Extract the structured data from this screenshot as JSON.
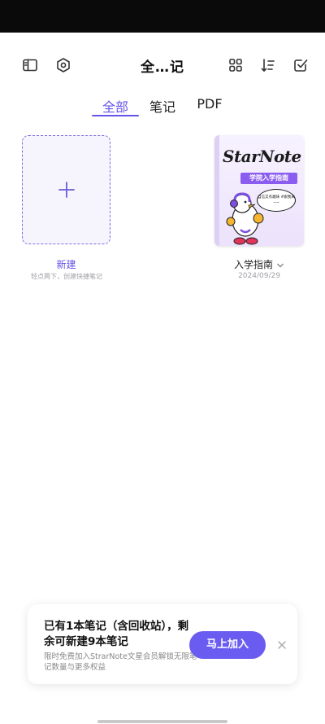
{
  "header": {
    "title": "全…记",
    "icons": [
      "sidebar-icon",
      "settings-hexagon-icon",
      "grid-view-icon",
      "sort-icon",
      "select-check-icon"
    ]
  },
  "tabs": [
    {
      "label": "全部",
      "active": true
    },
    {
      "label": "笔记",
      "active": false
    },
    {
      "label": "PDF",
      "active": false
    }
  ],
  "new_card": {
    "label": "新建",
    "hint": "轻点两下，创建快捷笔记",
    "icon": "plus-icon"
  },
  "notebook": {
    "cover_logo": "StarNote",
    "cover_banner": "学院入学指南",
    "cover_bubble": "自信又有趣味 #跟我来~~",
    "title": "入学指南",
    "date": "2024/09/29"
  },
  "promo": {
    "title": "已有1本笔记（含回收站），剩余可新建9本笔记",
    "subtitle": "限时免费加入StrarNote文星会员解锁无限笔记数量与更多权益",
    "button": "马上加入"
  },
  "colors": {
    "accent": "#6454e8",
    "button": "#6a5cf0",
    "status_bar": "#0a0a0a"
  }
}
